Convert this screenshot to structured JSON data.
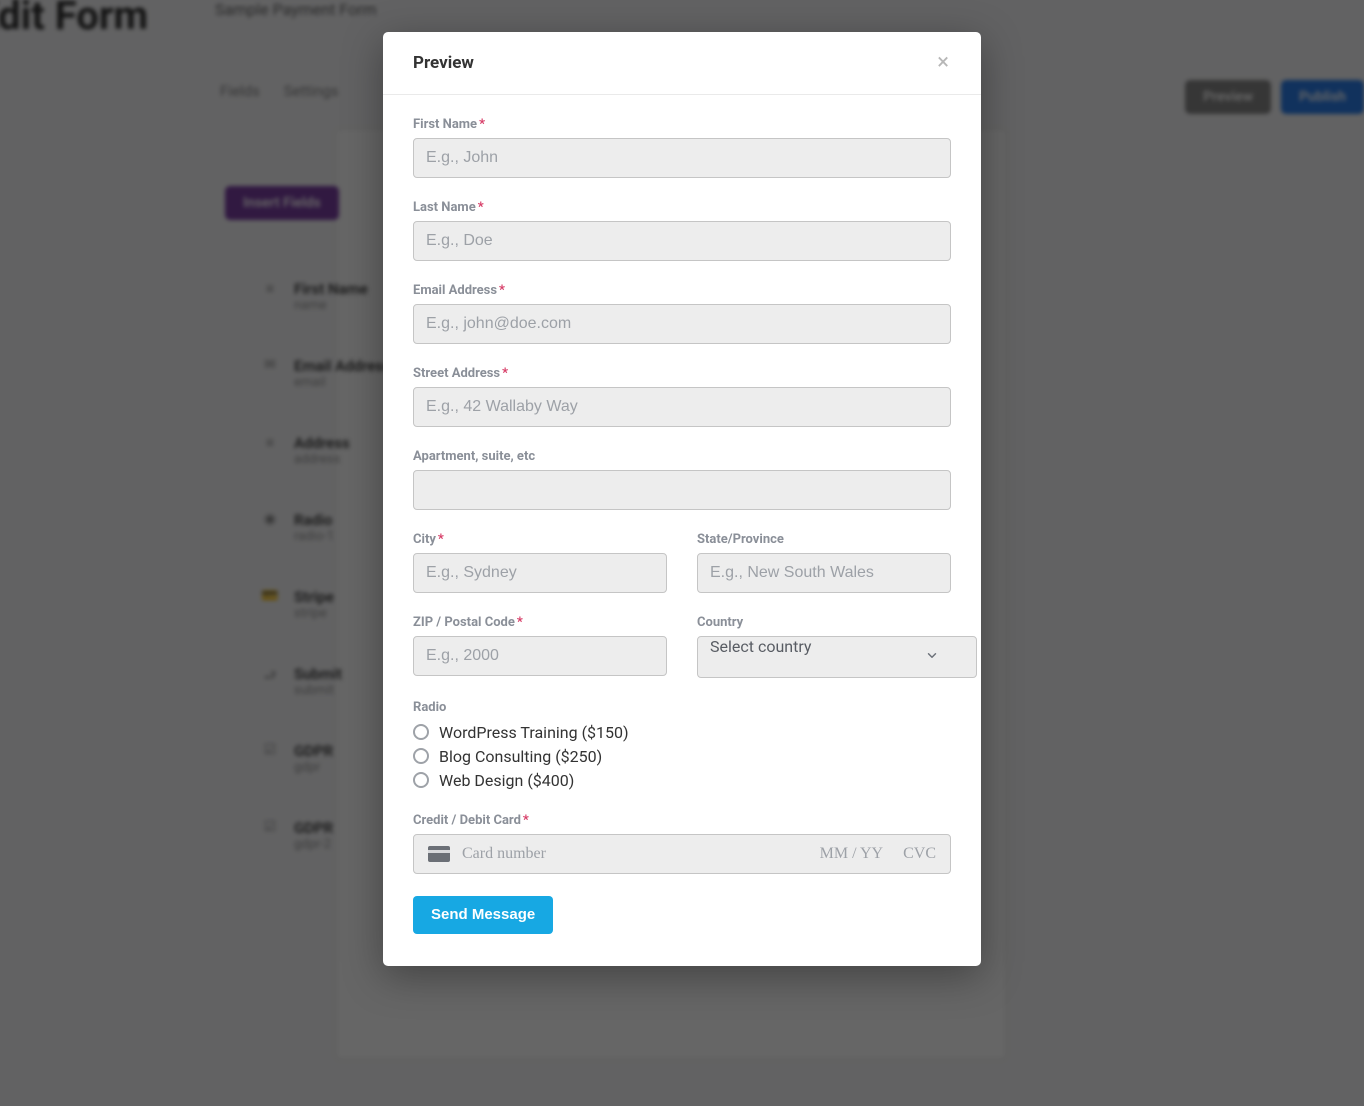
{
  "colors": {
    "accent": "#17a8e3",
    "required": "#d63964",
    "overlay": "rgba(0,0,0,0.6)",
    "purple": "#7b3fa3",
    "primary": "#2b7de9"
  },
  "background": {
    "page_title": "Edit Form",
    "sub_title": "Sample Payment Form",
    "tabs": [
      "Fields",
      "Settings"
    ],
    "buttons": {
      "preview": "Preview",
      "publish": "Publish"
    },
    "insert_fields": "Insert Fields",
    "fields_list": [
      {
        "title": "First Name",
        "sub": "name"
      },
      {
        "title": "Email Address",
        "sub": "email"
      },
      {
        "title": "Address",
        "sub": "address"
      },
      {
        "title": "Radio",
        "sub": "radio-1"
      },
      {
        "title": "Stripe",
        "sub": "stripe"
      },
      {
        "title": "Submit",
        "sub": "submit"
      },
      {
        "title": "GDPR",
        "sub": "gdpr"
      },
      {
        "title": "GDPR",
        "sub": "gdpr-2"
      }
    ]
  },
  "modal": {
    "title": "Preview",
    "close_label": "×",
    "fields": {
      "first_name": {
        "label": "First Name",
        "required": true,
        "placeholder": "E.g., John",
        "value": ""
      },
      "last_name": {
        "label": "Last Name",
        "required": true,
        "placeholder": "E.g., Doe",
        "value": ""
      },
      "email": {
        "label": "Email Address",
        "required": true,
        "placeholder": "E.g., john@doe.com",
        "value": ""
      },
      "street": {
        "label": "Street Address",
        "required": true,
        "placeholder": "E.g., 42 Wallaby Way",
        "value": ""
      },
      "apt": {
        "label": "Apartment, suite, etc",
        "required": false,
        "placeholder": "",
        "value": ""
      },
      "city": {
        "label": "City",
        "required": true,
        "placeholder": "E.g., Sydney",
        "value": ""
      },
      "state": {
        "label": "State/Province",
        "required": false,
        "placeholder": "E.g., New South Wales",
        "value": ""
      },
      "zip": {
        "label": "ZIP / Postal Code",
        "required": true,
        "placeholder": "E.g., 2000",
        "value": ""
      },
      "country": {
        "label": "Country",
        "required": false,
        "selected": "Select country"
      },
      "radio": {
        "label": "Radio",
        "options": [
          "WordPress Training ($150)",
          "Blog Consulting ($250)",
          "Web Design ($400)"
        ],
        "selected": null
      },
      "card": {
        "label": "Credit / Debit Card",
        "required": true,
        "placeholder_number": "Card number",
        "placeholder_expiry": "MM / YY",
        "placeholder_cvc": "CVC"
      }
    },
    "submit_label": "Send Message"
  }
}
